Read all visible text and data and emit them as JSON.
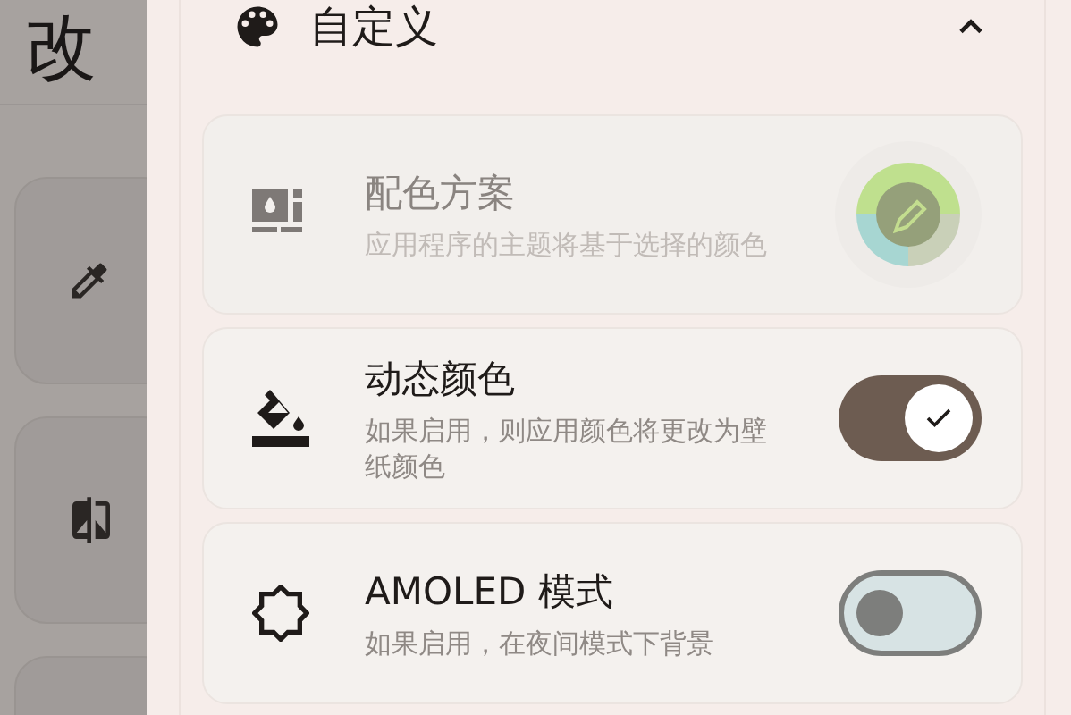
{
  "background_screen": {
    "title": "改",
    "tools": [
      {
        "kind": "eyedropper"
      },
      {
        "kind": "compare"
      },
      {
        "kind": "blank"
      }
    ]
  },
  "section": {
    "title": "自定义",
    "expanded": true
  },
  "settings": [
    {
      "kind": "color-scheme",
      "title": "配色方案",
      "description": "应用程序的主题将基于选择的颜色",
      "disabled": true
    },
    {
      "kind": "switch",
      "title": "动态颜色",
      "description": "如果启用，则应用颜色将更改为壁纸颜色",
      "disabled": false,
      "on": true
    },
    {
      "kind": "switch",
      "title": "AMOLED 模式",
      "description": "如果启用，在夜间模式下背景",
      "disabled": false,
      "on": false
    }
  ]
}
